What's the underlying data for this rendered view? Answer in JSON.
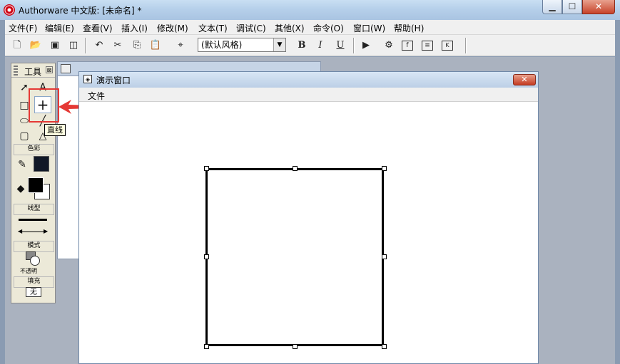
{
  "window": {
    "title": "Authorware 中文版: [未命名] *",
    "minimize": "▁",
    "maximize": "☐",
    "close": "✕"
  },
  "menubar": [
    "文件(F)",
    "编辑(E)",
    "查看(V)",
    "插入(I)",
    "修改(M)",
    "文本(T)",
    "调试(C)",
    "其他(X)",
    "命令(O)",
    "窗口(W)",
    "帮助(H)"
  ],
  "toolbar": {
    "icons": [
      "new-icon",
      "open-icon",
      "save-all-icon",
      "import-icon",
      "undo-icon",
      "cut-icon",
      "copy-icon",
      "paste-icon",
      "find-icon",
      "run-icon",
      "control-panel-icon",
      "functions-icon",
      "variables-icon",
      "knowledge-objects-icon"
    ],
    "text_style": "(默认风格)",
    "bold": "B",
    "italic": "I",
    "underline": "U"
  },
  "tools": {
    "title": "工具",
    "close": "⊠",
    "color_label": "色彩",
    "linetype_label": "线型",
    "mode_label": "模式",
    "mode_value": "不透明",
    "fill_label": "填充",
    "fill_value": "无",
    "line_tool_glyph": "+",
    "tooltip": "直线",
    "text_tool_glyph": "A",
    "colors": {
      "line": "#111827",
      "fill_fg": "#000000",
      "fill_bg": "#ffffff"
    }
  },
  "presentation": {
    "title": "演示窗口",
    "menu_file": "文件",
    "close": "✕"
  },
  "annotation": {
    "color": "#e53935"
  }
}
